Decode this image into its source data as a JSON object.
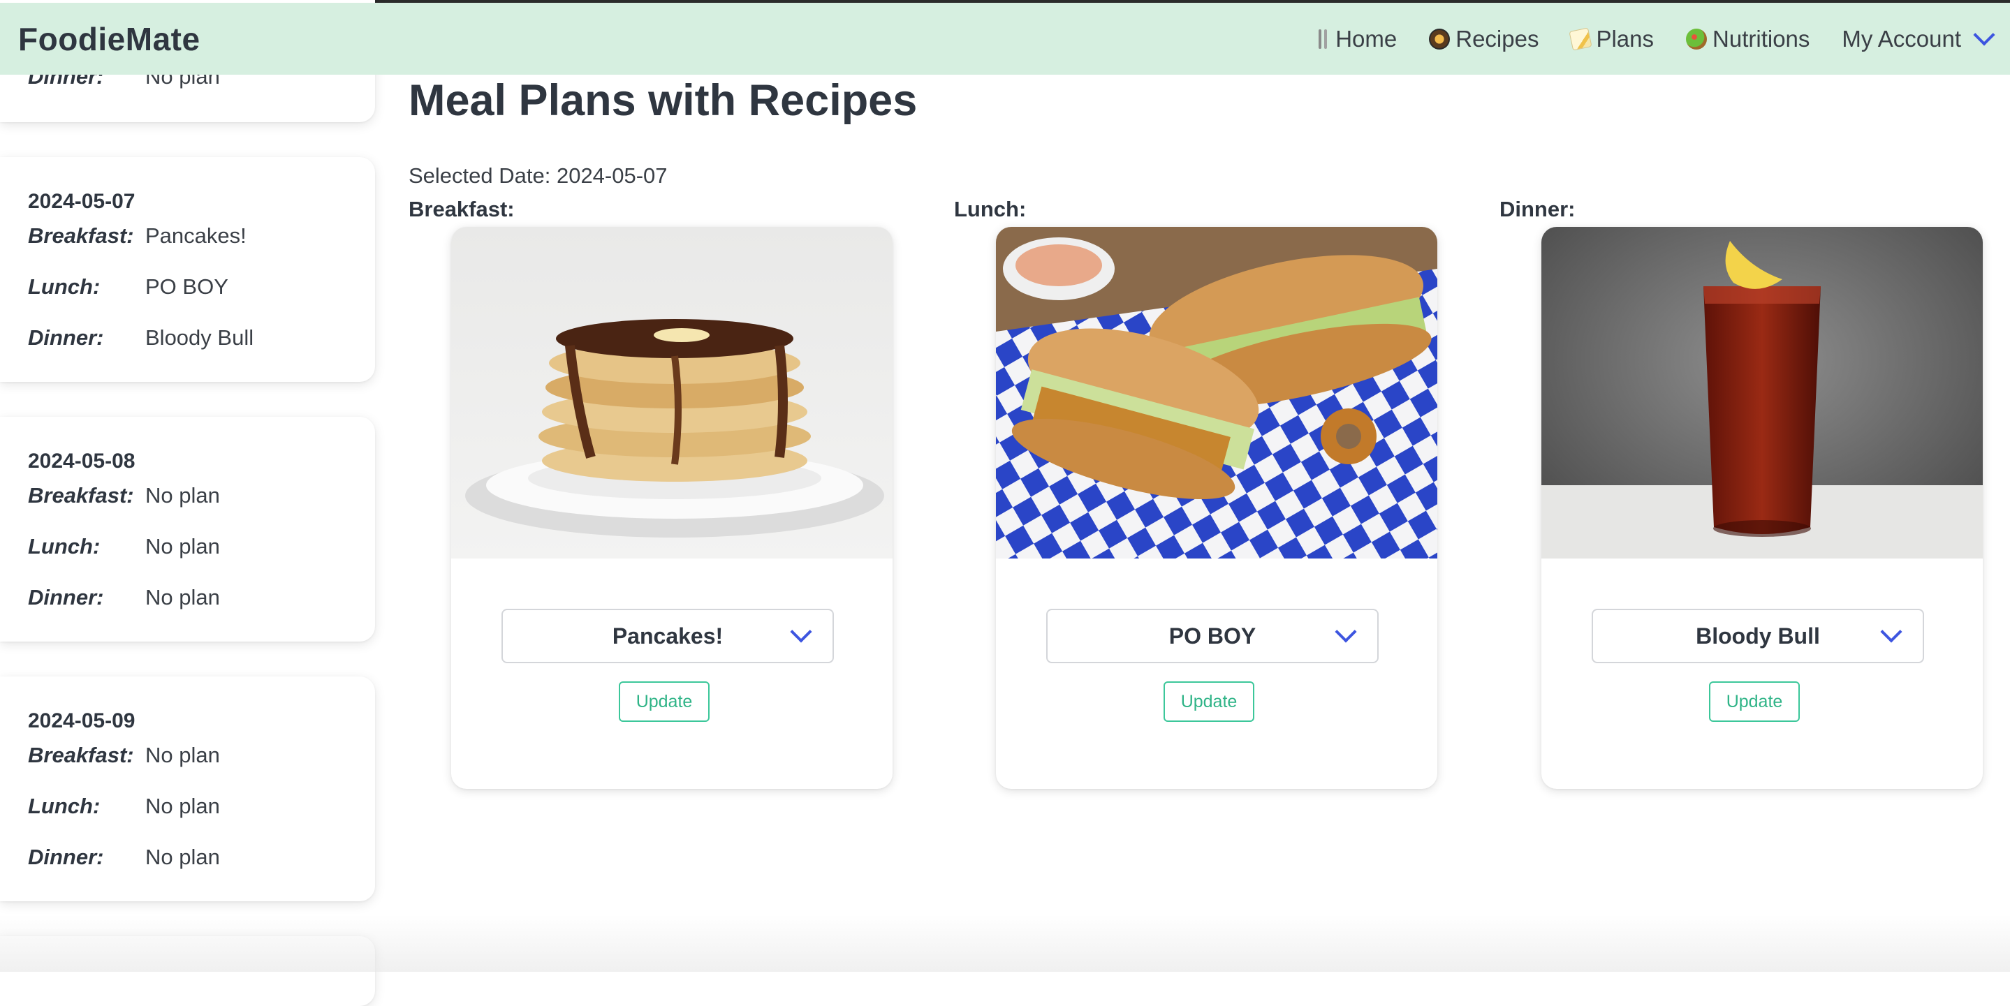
{
  "app": {
    "brand": "FoodieMate"
  },
  "nav": {
    "items": [
      {
        "label": "Home",
        "icon": "fork-knife-icon"
      },
      {
        "label": "Recipes",
        "icon": "cooking-pan-icon"
      },
      {
        "label": "Plans",
        "icon": "memo-icon"
      },
      {
        "label": "Nutritions",
        "icon": "salad-icon"
      }
    ],
    "account_label": "My Account"
  },
  "sidebar": {
    "labels": {
      "breakfast": "Breakfast:",
      "lunch": "Lunch:",
      "dinner": "Dinner:"
    },
    "days": [
      {
        "date": "",
        "breakfast": "",
        "lunch": "",
        "dinner": "No plan"
      },
      {
        "date": "2024-05-07",
        "breakfast": "Pancakes!",
        "lunch": "PO BOY",
        "dinner": "Bloody Bull"
      },
      {
        "date": "2024-05-08",
        "breakfast": "No plan",
        "lunch": "No plan",
        "dinner": "No plan"
      },
      {
        "date": "2024-05-09",
        "breakfast": "No plan",
        "lunch": "No plan",
        "dinner": "No plan"
      }
    ]
  },
  "main": {
    "title": "Meal Plans with Recipes",
    "selected_date_label": "Selected Date: 2024-05-07",
    "slots": [
      {
        "label": "Breakfast:",
        "selected_recipe": "Pancakes!",
        "update_label": "Update",
        "image": "pancakes-photo"
      },
      {
        "label": "Lunch:",
        "selected_recipe": "PO BOY",
        "update_label": "Update",
        "image": "po-boy-photo"
      },
      {
        "label": "Dinner:",
        "selected_recipe": "Bloody Bull",
        "update_label": "Update",
        "image": "bloody-bull-photo"
      }
    ]
  },
  "colors": {
    "navbar_bg": "#d6efe0",
    "accent_blue": "#3d55e0",
    "update_green": "#3cc79a",
    "text_dark": "#2f3640"
  }
}
